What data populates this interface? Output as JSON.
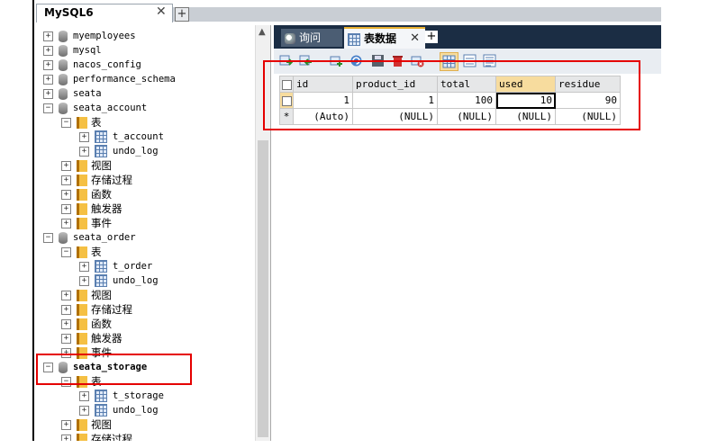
{
  "connection": {
    "title": "MySQL6",
    "close": "✕",
    "add": "+"
  },
  "tree": [
    {
      "pm": "+",
      "icon": "db",
      "label": "myemployees",
      "level": 0
    },
    {
      "pm": "+",
      "icon": "db",
      "label": "mysql",
      "level": 0
    },
    {
      "pm": "+",
      "icon": "db",
      "label": "nacos_config",
      "level": 0
    },
    {
      "pm": "+",
      "icon": "db",
      "label": "performance_schema",
      "level": 0
    },
    {
      "pm": "+",
      "icon": "db",
      "label": "seata",
      "level": 0
    },
    {
      "pm": "−",
      "icon": "db",
      "label": "seata_account",
      "level": 0
    },
    {
      "pm": "−",
      "icon": "folder",
      "label": "表",
      "level": 1
    },
    {
      "pm": "+",
      "icon": "table",
      "label": "t_account",
      "level": 2
    },
    {
      "pm": "+",
      "icon": "table",
      "label": "undo_log",
      "level": 2
    },
    {
      "pm": "+",
      "icon": "folder",
      "label": "视图",
      "level": 1
    },
    {
      "pm": "+",
      "icon": "folder",
      "label": "存储过程",
      "level": 1
    },
    {
      "pm": "+",
      "icon": "folder",
      "label": "函数",
      "level": 1
    },
    {
      "pm": "+",
      "icon": "folder",
      "label": "触发器",
      "level": 1
    },
    {
      "pm": "+",
      "icon": "folder",
      "label": "事件",
      "level": 1
    },
    {
      "pm": "−",
      "icon": "db",
      "label": "seata_order",
      "level": 0
    },
    {
      "pm": "−",
      "icon": "folder",
      "label": "表",
      "level": 1
    },
    {
      "pm": "+",
      "icon": "table",
      "label": "t_order",
      "level": 2
    },
    {
      "pm": "+",
      "icon": "table",
      "label": "undo_log",
      "level": 2
    },
    {
      "pm": "+",
      "icon": "folder",
      "label": "视图",
      "level": 1
    },
    {
      "pm": "+",
      "icon": "folder",
      "label": "存储过程",
      "level": 1
    },
    {
      "pm": "+",
      "icon": "folder",
      "label": "函数",
      "level": 1
    },
    {
      "pm": "+",
      "icon": "folder",
      "label": "触发器",
      "level": 1
    },
    {
      "pm": "+",
      "icon": "folder",
      "label": "事件",
      "level": 1
    },
    {
      "pm": "−",
      "icon": "db",
      "label": "seata_storage",
      "level": 0,
      "bold": true
    },
    {
      "pm": "−",
      "icon": "folder",
      "label": "表",
      "level": 1
    },
    {
      "pm": "+",
      "icon": "table",
      "label": "t_storage",
      "level": 2
    },
    {
      "pm": "+",
      "icon": "table",
      "label": "undo_log",
      "level": 2
    },
    {
      "pm": "+",
      "icon": "folder",
      "label": "视图",
      "level": 1
    },
    {
      "pm": "+",
      "icon": "folder",
      "label": "存储过程",
      "level": 1
    }
  ],
  "tabs": {
    "query": "询问",
    "table": "表数据",
    "close": "✕",
    "add": "+"
  },
  "grid": {
    "columns": [
      "id",
      "product_id",
      "total",
      "used",
      "residue"
    ],
    "row": [
      "1",
      "1",
      "100",
      "10",
      "90"
    ],
    "new_marker": "*",
    "new_row": [
      "(Auto)",
      "(NULL)",
      "(NULL)",
      "(NULL)",
      "(NULL)"
    ]
  },
  "colors": {
    "highlight": "#e50000",
    "tabbar": "#1b2d44",
    "accent": "#f7dc9e"
  }
}
